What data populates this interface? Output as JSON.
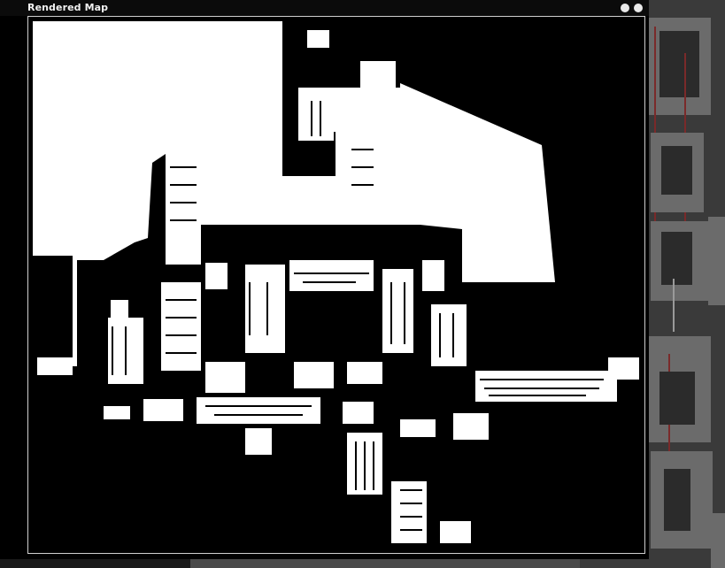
{
  "window": {
    "title": "Rendered Map",
    "buttons": [
      {
        "name": "minimize-button",
        "icon": "circle-icon"
      },
      {
        "name": "close-button",
        "icon": "circle-icon"
      }
    ]
  },
  "colors": {
    "map_walls": "#ffffff",
    "map_void": "#000000",
    "frame_border": "#cfcfcf",
    "background_floor": "#6b6b6b",
    "background_dark": "#2b2b2b",
    "background_lines": "#7a2a2a"
  }
}
